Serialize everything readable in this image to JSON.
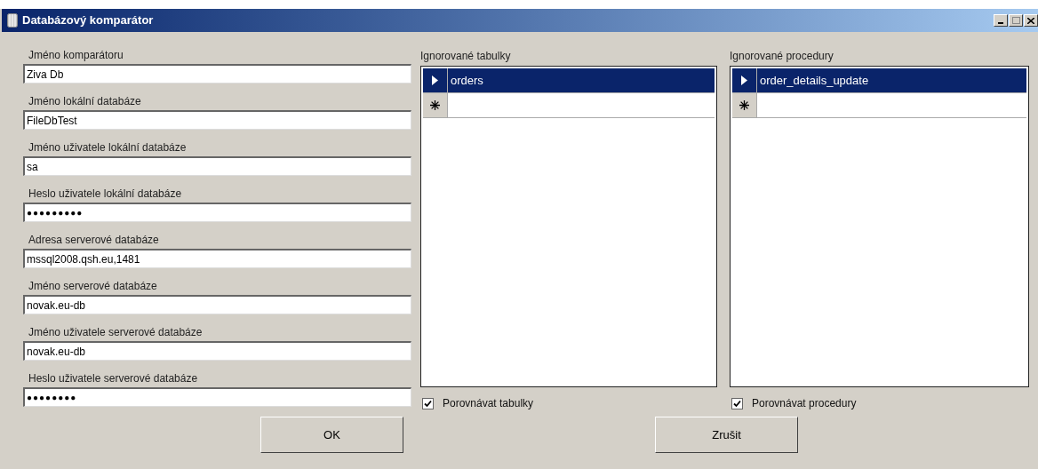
{
  "window": {
    "title": "Databázový komparátor"
  },
  "fields": [
    {
      "label": "Jméno komparátoru",
      "value": "Ziva Db",
      "kind": "text"
    },
    {
      "label": "Jméno lokální databáze",
      "value": "FileDbTest",
      "kind": "text"
    },
    {
      "label": "Jméno uživatele lokální databáze",
      "value": "sa",
      "kind": "text"
    },
    {
      "label": "Heslo uživatele lokální databáze",
      "value": "●●●●●●●●●",
      "kind": "password"
    },
    {
      "label": "Adresa serverové databáze",
      "value": "mssql2008.qsh.eu,1481",
      "kind": "text"
    },
    {
      "label": "Jméno serverové databáze",
      "value": "novak.eu-db",
      "kind": "text"
    },
    {
      "label": "Jméno uživatele serverové databáze",
      "value": "novak.eu-db",
      "kind": "text"
    },
    {
      "label": "Heslo uživatele serverové databáze",
      "value": "●●●●●●●●",
      "kind": "password"
    }
  ],
  "lists": [
    {
      "label": "Ignorované tabulky",
      "rows": [
        {
          "value": "orders",
          "selected": true
        }
      ],
      "checkbox": {
        "label": "Porovnávat tabulky",
        "checked": true
      }
    },
    {
      "label": "Ignorované procedury",
      "rows": [
        {
          "value": "order_details_update",
          "selected": true
        }
      ],
      "checkbox": {
        "label": "Porovnávat procedury",
        "checked": true
      }
    }
  ],
  "buttons": [
    "OK",
    "Zrušit"
  ]
}
